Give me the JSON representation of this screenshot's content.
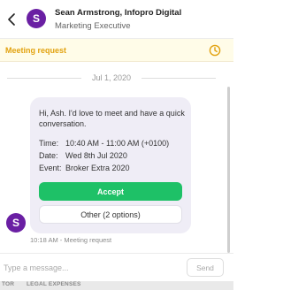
{
  "header": {
    "contact_name": "Sean Armstrong, Infopro Digital",
    "contact_role": "Marketing Executive",
    "avatar_initial": "S",
    "avatar_color": "#6a1fa3"
  },
  "banner": {
    "label": "Meeting request",
    "accent_color": "#e2a20f",
    "icon": "clock-icon"
  },
  "conversation": {
    "date_separator": "Jul 1, 2020",
    "message": {
      "greeting": "Hi, Ash. I'd love to meet and have a quick conversation.",
      "time_label": "Time:",
      "time_value": "10:40 AM - 11:00 AM (+0100)",
      "date_label": "Date:",
      "date_value": "Wed 8th Jul 2020",
      "event_label": "Event:",
      "event_value": "Broker Extra 2020",
      "accept_label": "Accept",
      "other_label": "Other (2 options)",
      "accept_color": "#1ec167"
    },
    "sender_avatar_initial": "S",
    "meta": "10:18 AM - Meeting request"
  },
  "composer": {
    "placeholder": "Type a message...",
    "send_label": "Send"
  },
  "background_strip": {
    "left_text": "TOR",
    "right_text": "LEGAL EXPENSES"
  }
}
